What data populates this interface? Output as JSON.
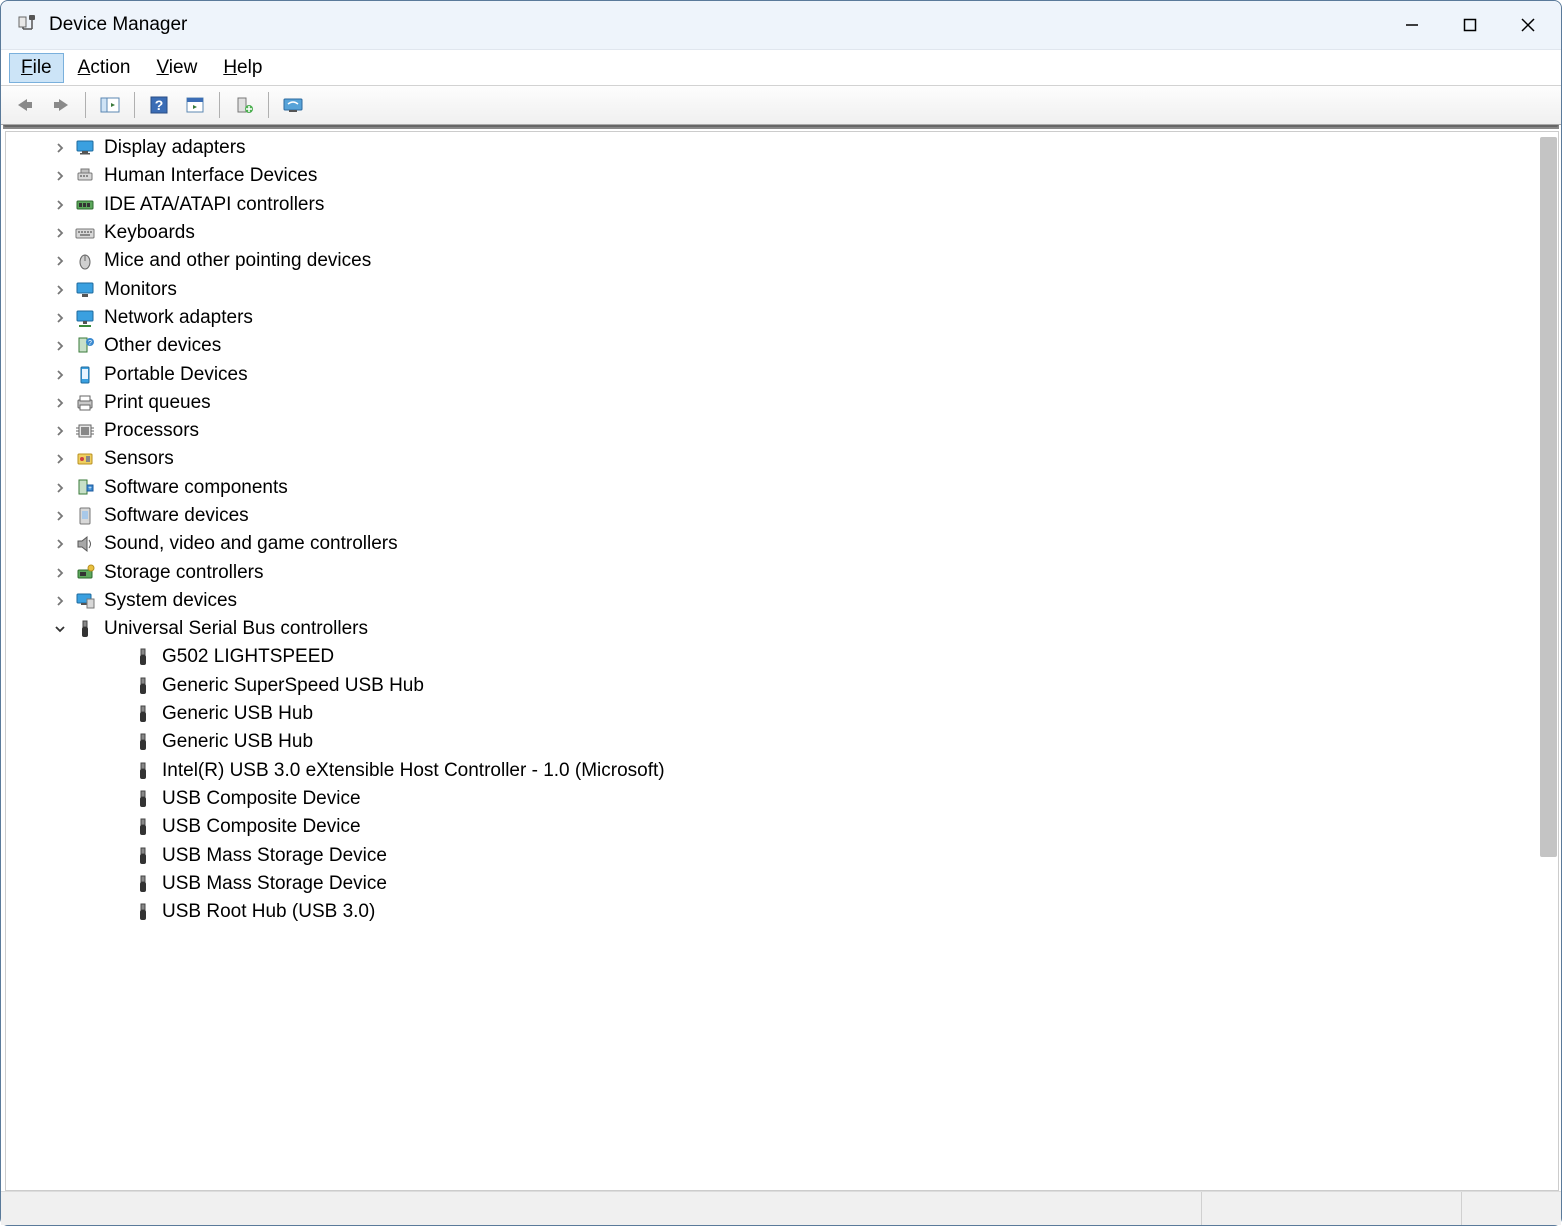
{
  "window": {
    "title": "Device Manager"
  },
  "menu": {
    "file": "File",
    "action": "Action",
    "view": "View",
    "help": "Help"
  },
  "toolbar": {
    "back": "Back",
    "forward": "Forward",
    "show_hide": "Show/Hide Console Tree",
    "help": "Help",
    "properties": "Properties",
    "update": "Update Driver",
    "scan": "Scan for hardware changes"
  },
  "tree": {
    "categories": [
      {
        "label": "Display adapters",
        "icon": "display"
      },
      {
        "label": "Human Interface Devices",
        "icon": "hid"
      },
      {
        "label": "IDE ATA/ATAPI controllers",
        "icon": "ide"
      },
      {
        "label": "Keyboards",
        "icon": "keyboard"
      },
      {
        "label": "Mice and other pointing devices",
        "icon": "mouse"
      },
      {
        "label": "Monitors",
        "icon": "monitor"
      },
      {
        "label": "Network adapters",
        "icon": "network"
      },
      {
        "label": "Other devices",
        "icon": "other"
      },
      {
        "label": "Portable Devices",
        "icon": "portable"
      },
      {
        "label": "Print queues",
        "icon": "printer"
      },
      {
        "label": "Processors",
        "icon": "cpu"
      },
      {
        "label": "Sensors",
        "icon": "sensor"
      },
      {
        "label": "Software components",
        "icon": "swcomp"
      },
      {
        "label": "Software devices",
        "icon": "swdev"
      },
      {
        "label": "Sound, video and game controllers",
        "icon": "sound"
      },
      {
        "label": "Storage controllers",
        "icon": "storage"
      },
      {
        "label": "System devices",
        "icon": "system"
      }
    ],
    "expanded": {
      "label": "Universal Serial Bus controllers",
      "icon": "usb",
      "children": [
        {
          "label": "G502 LIGHTSPEED"
        },
        {
          "label": "Generic SuperSpeed USB Hub"
        },
        {
          "label": "Generic USB Hub"
        },
        {
          "label": "Generic USB Hub"
        },
        {
          "label": "Intel(R) USB 3.0 eXtensible Host Controller - 1.0 (Microsoft)"
        },
        {
          "label": "USB Composite Device"
        },
        {
          "label": "USB Composite Device"
        },
        {
          "label": "USB Mass Storage Device"
        },
        {
          "label": "USB Mass Storage Device"
        },
        {
          "label": "USB Root Hub (USB 3.0)"
        }
      ]
    }
  }
}
